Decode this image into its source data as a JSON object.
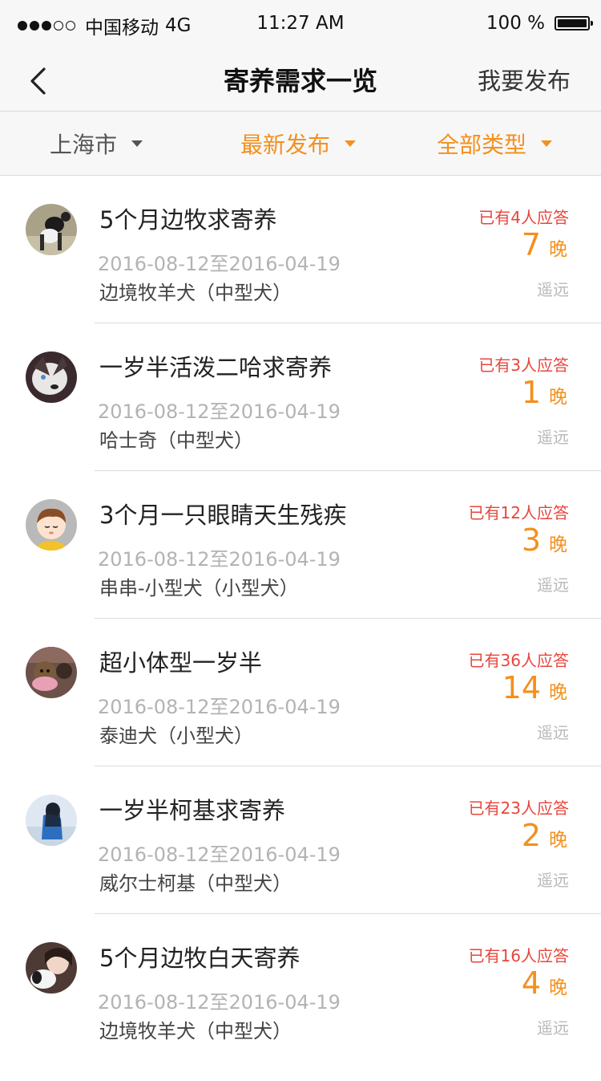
{
  "status_bar": {
    "carrier": "中国移动",
    "network": "4G",
    "time": "11:27 AM",
    "battery": "100 %"
  },
  "nav": {
    "title": "寄养需求一览",
    "action_label": "我要发布",
    "back_icon": "chevron-left-icon"
  },
  "filters": {
    "city": "上海市",
    "sort": "最新发布",
    "type": "全部类型",
    "accent_color": "#f3901e"
  },
  "list": [
    {
      "title": "5个月边牧求寄养",
      "dates": "2016-08-12至2016-04-19",
      "breed": "边境牧羊犬（中型犬）",
      "replies": "已有4人应答",
      "nights": "7",
      "nights_unit": "晚",
      "distance": "遥远"
    },
    {
      "title": "一岁半活泼二哈求寄养",
      "dates": "2016-08-12至2016-04-19",
      "breed": "哈士奇（中型犬）",
      "replies": "已有3人应答",
      "nights": "1",
      "nights_unit": "晚",
      "distance": "遥远"
    },
    {
      "title": "3个月一只眼睛天生残疾",
      "dates": "2016-08-12至2016-04-19",
      "breed": "串串-小型犬（小型犬）",
      "replies": "已有12人应答",
      "nights": "3",
      "nights_unit": "晚",
      "distance": "遥远"
    },
    {
      "title": "超小体型一岁半",
      "dates": "2016-08-12至2016-04-19",
      "breed": "泰迪犬（小型犬）",
      "replies": "已有36人应答",
      "nights": "14",
      "nights_unit": "晚",
      "distance": "遥远"
    },
    {
      "title": "一岁半柯基求寄养",
      "dates": "2016-08-12至2016-04-19",
      "breed": "威尔士柯基（中型犬）",
      "replies": "已有23人应答",
      "nights": "2",
      "nights_unit": "晚",
      "distance": "遥远"
    },
    {
      "title": "5个月边牧白天寄养",
      "dates": "2016-08-12至2016-04-19",
      "breed": "边境牧羊犬（中型犬）",
      "replies": "已有16人应答",
      "nights": "4",
      "nights_unit": "晚",
      "distance": "遥远"
    }
  ],
  "colors": {
    "reply_red": "#e8453c",
    "orange": "#f3901e",
    "muted_gray": "#b3b3b3"
  }
}
